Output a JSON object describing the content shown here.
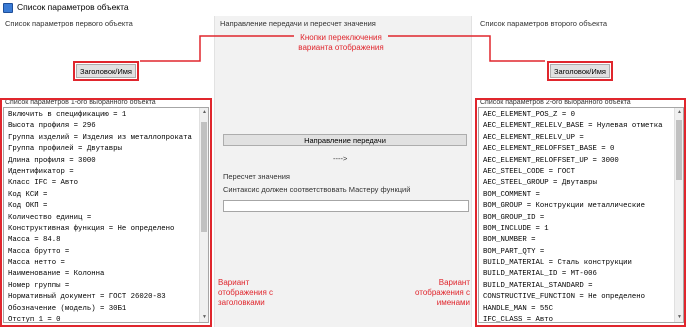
{
  "window": {
    "title": "Список параметров объекта"
  },
  "left": {
    "caption": "Список параметров первого объекта",
    "toggle_button": "Заголовок/Имя",
    "list_caption": "Список параметров 1-ого выбранного объекта",
    "items": [
      "Включить в спецификацию = 1",
      "Высота профиля = 296",
      "Группа изделий = Изделия из металлопроката",
      "Группа профилей = Двутавры",
      "Длина профиля  = 3000",
      "Идентификатор =",
      "Класс IFC = Авто",
      "Код КСИ =",
      "Код ОКП =",
      "Количество единиц =",
      "Конструктивная функция = Не определено",
      "Масса = 84.8",
      "Масса брутто =",
      "Масса нетто =",
      "Наименование = Колонна",
      "Номер группы =",
      "Нормативный документ = ГОСТ 26020-83",
      "Обозначение (модель) = 30Б1",
      "Отступ 1 = 0"
    ]
  },
  "middle": {
    "caption": "Направление передачи и пересчет значения",
    "transfer_button": "Направление передачи",
    "arrow": "---->",
    "recalc_label": "Пересчет значения",
    "syntax_hint": "Синтаксис должен соответствовать Мастеру функций",
    "recalc_value": ""
  },
  "right": {
    "caption": "Список параметров второго объекта",
    "toggle_button": "Заголовок/Имя",
    "list_caption": "Список параметров 2-ого выбранного объекта",
    "items": [
      "AEC_ELEMENT_POS_Z = 0",
      "AEC_ELEMENT_RELELV_BASE = Нулевая отметка",
      "AEC_ELEMENT_RELELV_UP =",
      "AEC_ELEMENT_RELOFFSET_BASE = 0",
      "AEC_ELEMENT_RELOFFSET_UP = 3000",
      "AEC_STEEL_CODE = ГОСТ",
      "AEC_STEEL_GROUP = Двутавры",
      "BOM_COMMENT =",
      "BOM_GROUP = Конструкции металлические",
      "BOM_GROUP_ID =",
      "BOM_INCLUDE = 1",
      "BOM_NUMBER =",
      "BOM_PART_QTY =",
      "BUILD_MATERIAL = Сталь конструкции",
      "BUILD_MATERIAL_ID = МТ-006",
      "BUILD_MATERIAL_STANDARD =",
      "CONSTRUCTIVE_FUNCTION = Не определено",
      "HANDLE_MAN = 55C",
      "IFC_CLASS = Авто"
    ]
  },
  "annotations": {
    "buttons_note": "Кнопки переключения\nварианта отображения",
    "left_note": "Вариант\nотображения с\nзаголовками",
    "right_note": "Вариант\nотображения с\nименами"
  },
  "colors": {
    "annotation": "#e0262d"
  }
}
